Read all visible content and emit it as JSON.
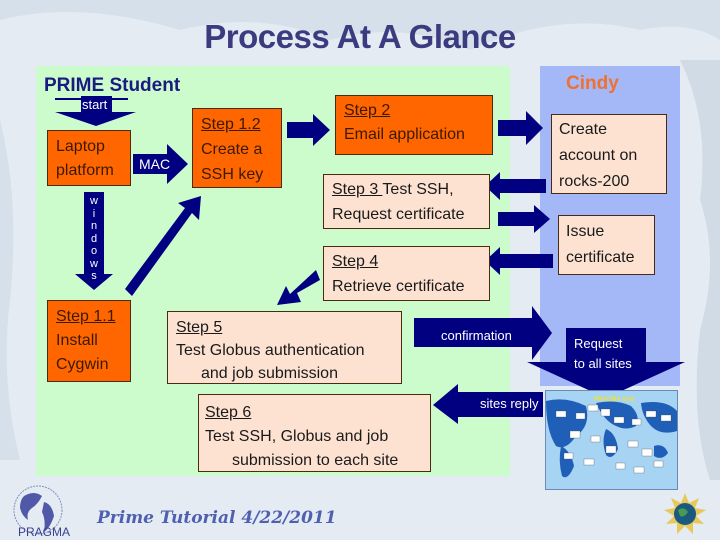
{
  "title": "Process At A Glance",
  "panels": {
    "student": "PRIME Student",
    "cindy": "Cindy"
  },
  "colors": {
    "title": "#3b3b80",
    "student_panel": "#ccfccc",
    "cindy_panel": "#a4b8f8",
    "orange_box": "#ff6600",
    "peach_box": "#fde2d2",
    "arrow": "#000080",
    "cindy_title": "#f07030"
  },
  "arrows": {
    "start": "start",
    "mac": "MAC",
    "windows": "windows",
    "confirmation": "confirmation",
    "request": [
      "Request",
      "to all sites"
    ],
    "sites_reply": "sites reply"
  },
  "boxes": {
    "laptop": [
      "Laptop",
      "platform"
    ],
    "step11": {
      "heading": "Step 1.1",
      "lines": [
        "Install",
        "Cygwin"
      ]
    },
    "step12": {
      "heading": "Step 1.2",
      "lines": [
        "Create a",
        "SSH key"
      ]
    },
    "step2": {
      "heading": "Step 2",
      "lines": [
        "Email application"
      ]
    },
    "step3": {
      "heading": "Step 3 ",
      "rest": "Test SSH,",
      "lines": [
        "Request certificate"
      ]
    },
    "step4": {
      "heading": "Step 4",
      "lines": [
        "Retrieve certificate"
      ]
    },
    "step5": {
      "heading": "Step 5",
      "lines": [
        "Test Globus authentication",
        "and job submission"
      ]
    },
    "step6": {
      "heading": "Step 6",
      "lines": [
        "Test SSH, Globus and job",
        "submission to each site"
      ]
    },
    "create_account": [
      "Create",
      "account on",
      "rocks-200"
    ],
    "issue_cert": [
      "Issue",
      "certificate"
    ]
  },
  "map": {
    "label": "PRAGMA Grid"
  },
  "footer": {
    "text": "Prime Tutorial 4/22/2011",
    "logo": "PRAGMA"
  }
}
